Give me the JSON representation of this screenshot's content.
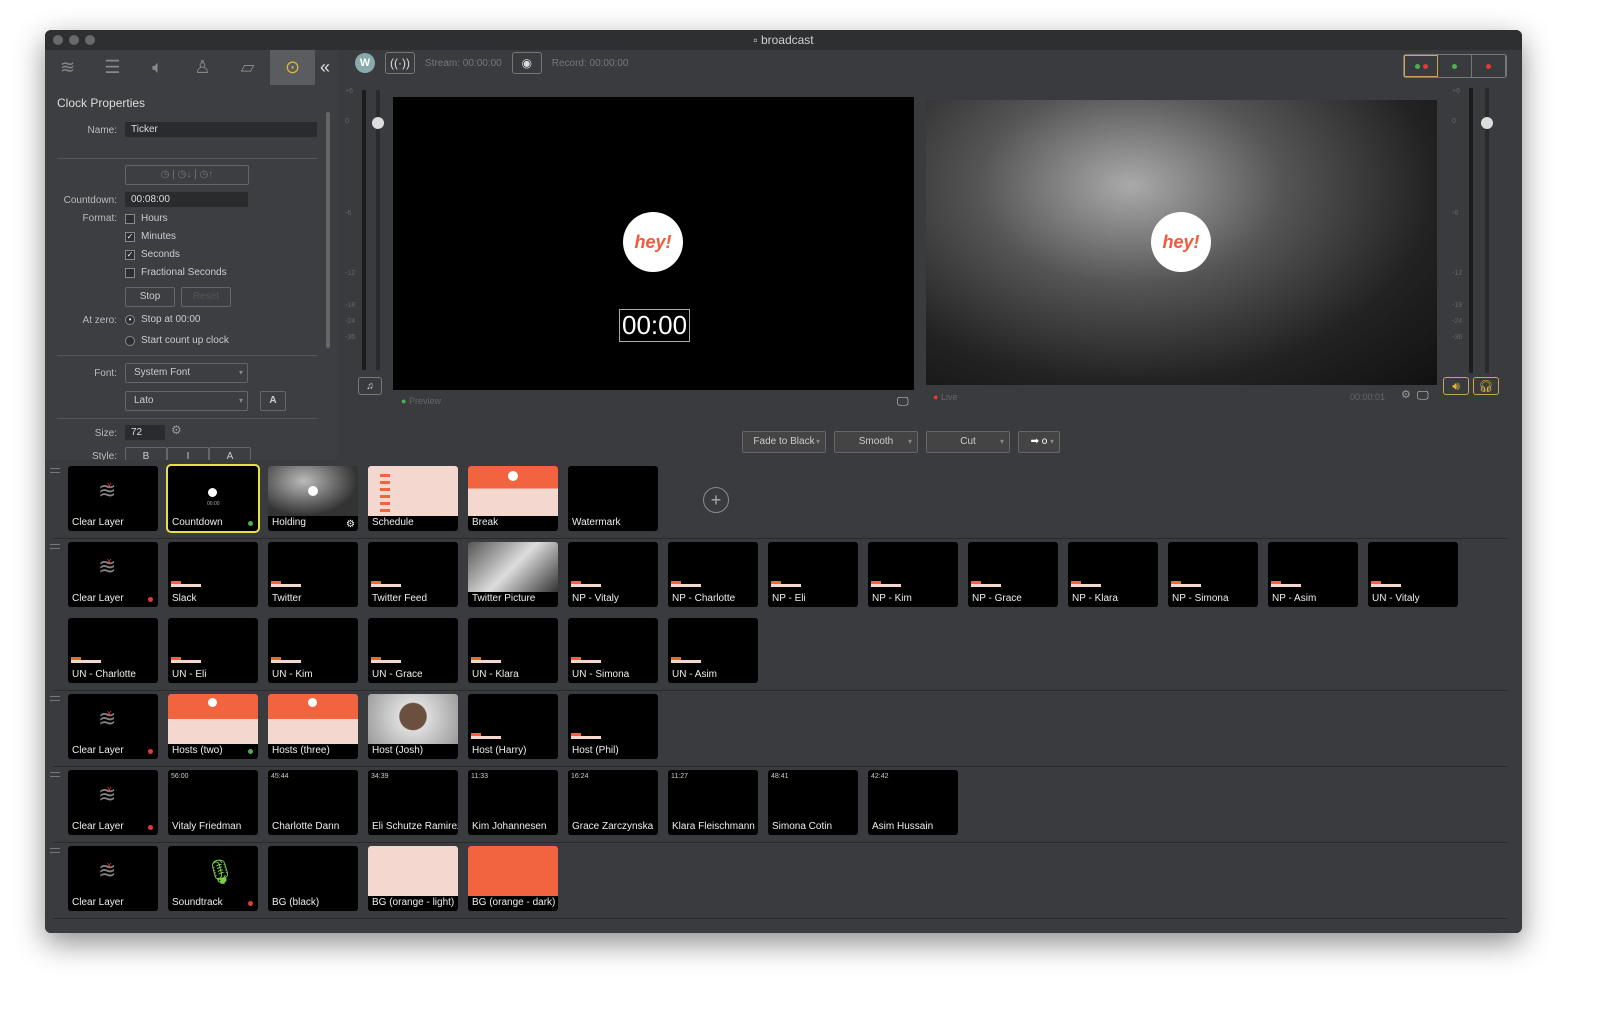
{
  "window": {
    "title": "broadcast"
  },
  "sidebar": {
    "tabs": [
      "layers-icon",
      "sliders-icon",
      "audio-icon",
      "person-icon",
      "shape-icon",
      "more-icon"
    ],
    "collapse_icon": "double-chevron-left-icon"
  },
  "clock_properties": {
    "title": "Clock Properties",
    "name_label": "Name:",
    "name_value": "Ticker",
    "countdown_label": "Countdown:",
    "countdown_value": "00:08:00",
    "format_label": "Format:",
    "formats": [
      {
        "label": "Hours",
        "checked": false
      },
      {
        "label": "Minutes",
        "checked": true
      },
      {
        "label": "Seconds",
        "checked": true
      },
      {
        "label": "Fractional Seconds",
        "checked": false
      }
    ],
    "stop_label": "Stop",
    "reset_label": "Reset",
    "at_zero_label": "At zero:",
    "at_zero_options": [
      {
        "label": "Stop at 00:00",
        "selected": true
      },
      {
        "label": "Start count up clock",
        "selected": false
      }
    ],
    "font_label": "Font:",
    "font_value": "System Font",
    "font_face": "Lato",
    "size_label": "Size:",
    "size_value": "72",
    "style_label": "Style:",
    "style_buttons": [
      "B",
      "I",
      "A"
    ]
  },
  "toolbar": {
    "stream_label": "Stream: 00:00:00",
    "record_label": "Record: 00:00:00"
  },
  "preview": {
    "label": "Preview",
    "clock_text": "00:00",
    "logo_text": "hey!"
  },
  "live": {
    "label": "Live",
    "timecode": "00:00:01",
    "logo_text": "hey!"
  },
  "meter_ticks": [
    "+6",
    "0",
    "-6",
    "-12",
    "-18",
    "-24",
    "-36"
  ],
  "transitions": {
    "fade": "Fade to Black",
    "smooth": "Smooth",
    "cut": "Cut",
    "go_symbol": "o"
  },
  "colors": {
    "accent": "#d9b73a",
    "orange": "#f26440",
    "orange_light": "#f4d7cf",
    "live": "#e53935",
    "preview": "#4caf50"
  },
  "layers": [
    {
      "rows": [
        [
          {
            "name": "Clear Layer",
            "thumb": "clear"
          },
          {
            "name": "Countdown",
            "thumb": "clock",
            "ind": "green",
            "selected": true
          },
          {
            "name": "Holding",
            "thumb": "photo",
            "ind": "gear"
          },
          {
            "name": "Schedule",
            "thumb": "schedule"
          },
          {
            "name": "Break",
            "thumb": "break"
          },
          {
            "name": "Watermark",
            "thumb": "black"
          }
        ]
      ],
      "add": true
    },
    {
      "rows": [
        [
          {
            "name": "Clear Layer",
            "thumb": "clear",
            "ind": "red"
          },
          {
            "name": "Slack",
            "thumb": "lt"
          },
          {
            "name": "Twitter",
            "thumb": "lt"
          },
          {
            "name": "Twitter Feed",
            "thumb": "lt"
          },
          {
            "name": "Twitter Picture",
            "thumb": "desk"
          },
          {
            "name": "NP - Vitaly",
            "thumb": "lt"
          },
          {
            "name": "NP - Charlotte",
            "thumb": "lt"
          },
          {
            "name": "NP - Eli",
            "thumb": "lt"
          },
          {
            "name": "NP - Kim",
            "thumb": "lt"
          },
          {
            "name": "NP - Grace",
            "thumb": "lt"
          },
          {
            "name": "NP - Klara",
            "thumb": "lt"
          },
          {
            "name": "NP - Simona",
            "thumb": "lt"
          },
          {
            "name": "NP - Asim",
            "thumb": "lt"
          },
          {
            "name": "UN - Vitaly",
            "thumb": "lt"
          }
        ],
        [
          {
            "name": "UN - Charlotte",
            "thumb": "lt"
          },
          {
            "name": "UN - Eli",
            "thumb": "lt"
          },
          {
            "name": "UN - Kim",
            "thumb": "lt"
          },
          {
            "name": "UN - Grace",
            "thumb": "lt"
          },
          {
            "name": "UN - Klara",
            "thumb": "lt"
          },
          {
            "name": "UN - Simona",
            "thumb": "lt"
          },
          {
            "name": "UN - Asim",
            "thumb": "lt"
          }
        ]
      ]
    },
    {
      "rows": [
        [
          {
            "name": "Clear Layer",
            "thumb": "clear",
            "ind": "red"
          },
          {
            "name": "Hosts (two)",
            "thumb": "hosts",
            "ind": "green"
          },
          {
            "name": "Hosts (three)",
            "thumb": "hosts"
          },
          {
            "name": "Host (Josh)",
            "thumb": "person"
          },
          {
            "name": "Host (Harry)",
            "thumb": "lt"
          },
          {
            "name": "Host (Phil)",
            "thumb": "lt"
          }
        ]
      ]
    },
    {
      "rows": [
        [
          {
            "name": "Clear Layer",
            "thumb": "clear",
            "ind": "red"
          },
          {
            "name": "Vitaly Friedman",
            "time": "56:00"
          },
          {
            "name": "Charlotte Dann",
            "time": "45:44"
          },
          {
            "name": "Eli Schutze Ramirez",
            "time": "34:39"
          },
          {
            "name": "Kim Johannesen",
            "time": "11:33"
          },
          {
            "name": "Grace Zarczynska",
            "time": "16:24"
          },
          {
            "name": "Klara Fleischmann",
            "time": "11:27"
          },
          {
            "name": "Simona Cotin",
            "time": "48:41"
          },
          {
            "name": "Asim Hussain",
            "time": "42:42"
          }
        ]
      ]
    },
    {
      "rows": [
        [
          {
            "name": "Clear Layer",
            "thumb": "clear"
          },
          {
            "name": "Soundtrack",
            "thumb": "mic",
            "ind": "red"
          },
          {
            "name": "BG (black)",
            "thumb": "black"
          },
          {
            "name": "BG (orange - light)",
            "thumb": "light"
          },
          {
            "name": "BG (orange - dark)",
            "thumb": "dark"
          }
        ]
      ]
    }
  ]
}
